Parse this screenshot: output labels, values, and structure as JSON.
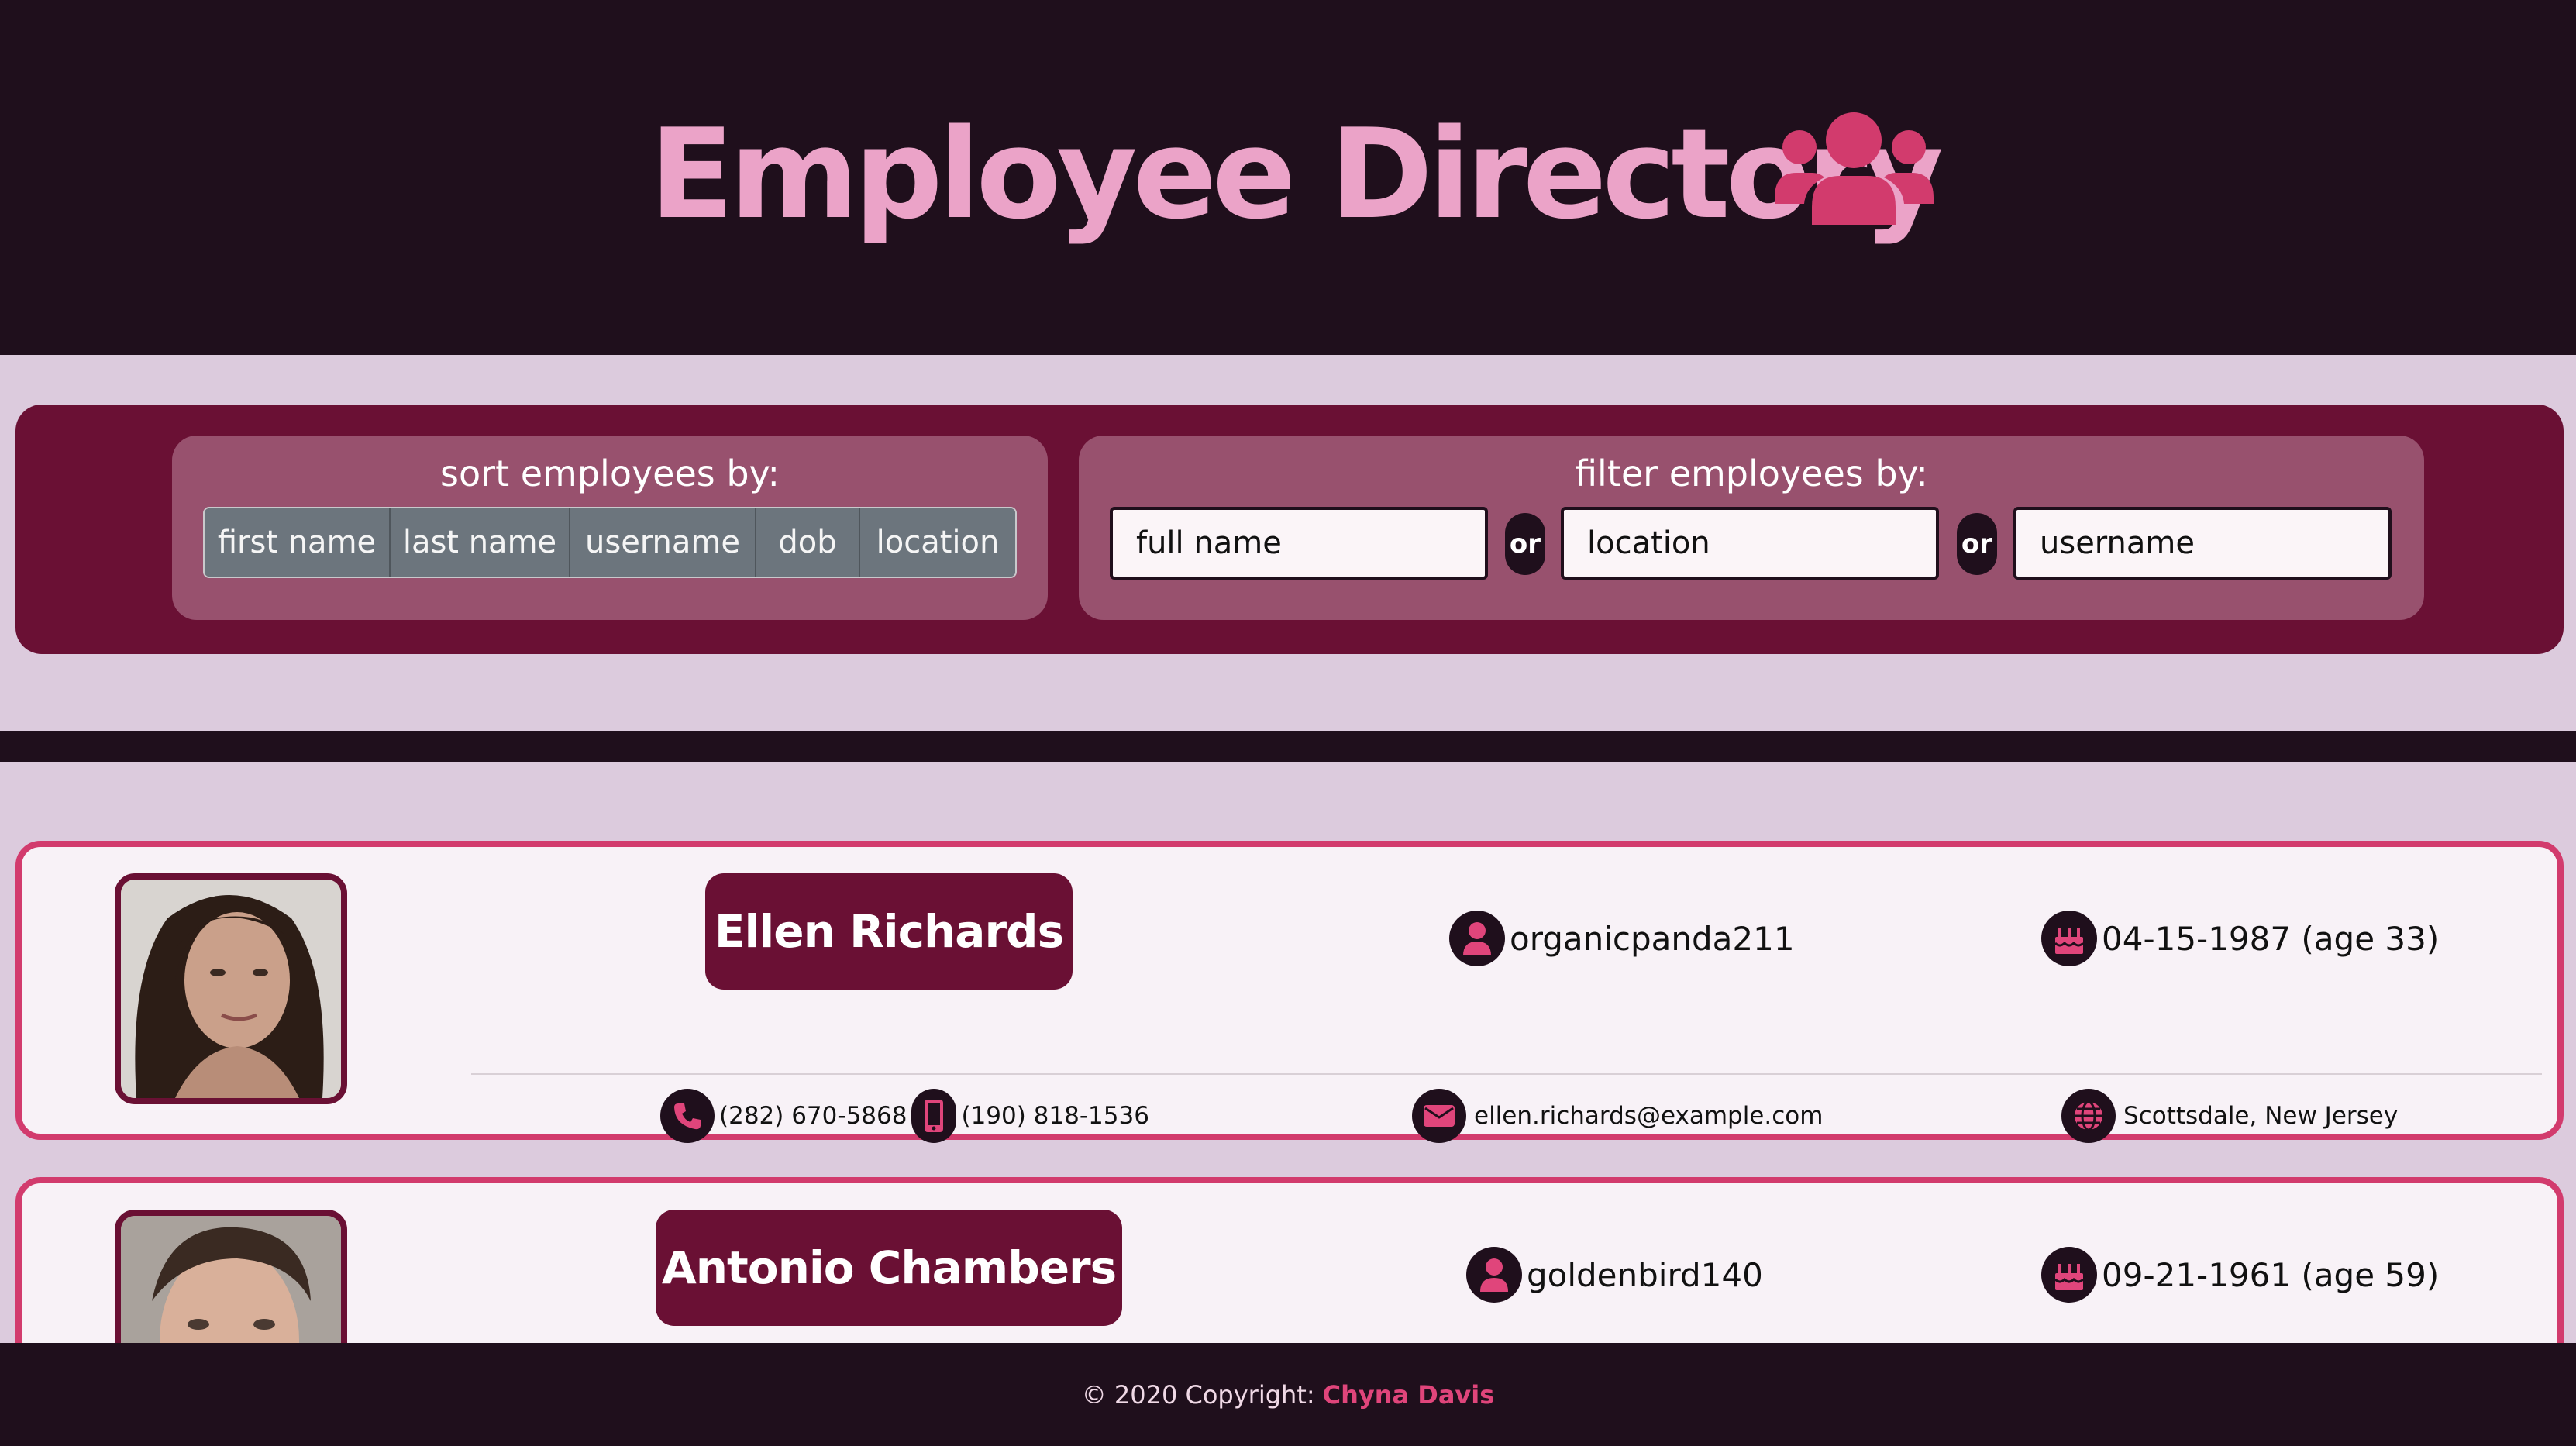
{
  "header": {
    "title": "Employee Directory",
    "icon": "users-icon",
    "colors": {
      "title": "#eba3c8",
      "icon": "#d23b6d",
      "background": "#1f0f1c"
    }
  },
  "sort": {
    "label": "sort employees by:",
    "buttons": [
      "first name",
      "last name",
      "username",
      "dob",
      "location"
    ]
  },
  "filter": {
    "label": "filter employees by:",
    "inputs": [
      {
        "placeholder": "full name"
      },
      {
        "placeholder": "location"
      },
      {
        "placeholder": "username"
      }
    ],
    "or_label": "or"
  },
  "employees": [
    {
      "name": "Ellen Richards",
      "username": "organicpanda211",
      "dob": "04-15-1987 (age 33)",
      "phone": "(282) 670-5868",
      "cell": "(190) 818-1536",
      "email": "ellen.richards@example.com",
      "location": "Scottsdale, New Jersey"
    },
    {
      "name": "Antonio Chambers",
      "username": "goldenbird140",
      "dob": "09-21-1961 (age 59)"
    }
  ],
  "footer": {
    "copyright": "© 2020 Copyright:",
    "author": "Chyna Davis"
  },
  "theme": {
    "accent": "#d23b6d",
    "dark": "#1f0f1c",
    "maroon": "#6a1034",
    "panel": "#98516e",
    "lavender": "#dccbdd"
  }
}
